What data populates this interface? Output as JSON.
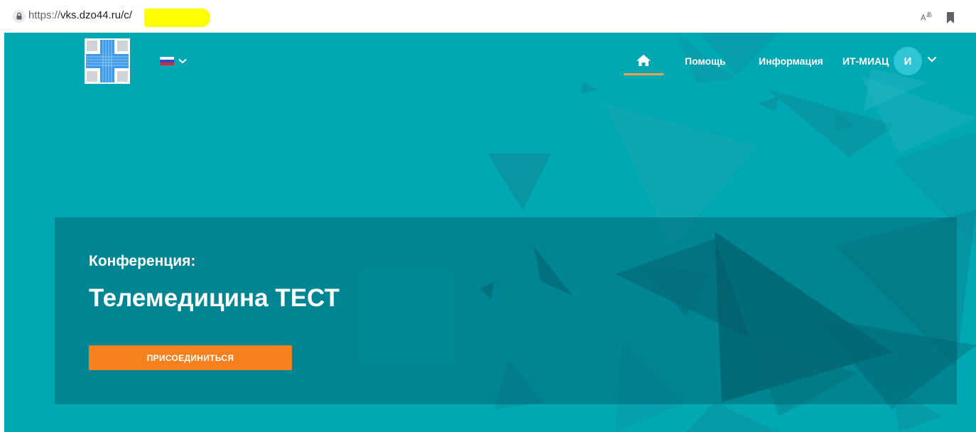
{
  "browser": {
    "url_protocol": "https://",
    "url_rest": "vks.dzo44.ru/c/",
    "translate_icon": "translate-icon",
    "bookmark_icon": "bookmark-icon",
    "lock_icon": "lock-icon"
  },
  "header": {
    "language": "ru",
    "nav": {
      "help": "Помощь",
      "info": "Информация",
      "user": "ИТ-МИАЦ"
    },
    "avatar_initial": "И"
  },
  "conference": {
    "label": "Конференция:",
    "title": "Телемедицина ТЕСТ",
    "join_label": "ПРИСОЕДИНИТЬСЯ"
  },
  "colors": {
    "background": "#00a8b4",
    "accent_button": "#f5801e",
    "nav_underline": "#f5a04a",
    "avatar": "#2fc4d6",
    "redaction": "#ffff00"
  }
}
